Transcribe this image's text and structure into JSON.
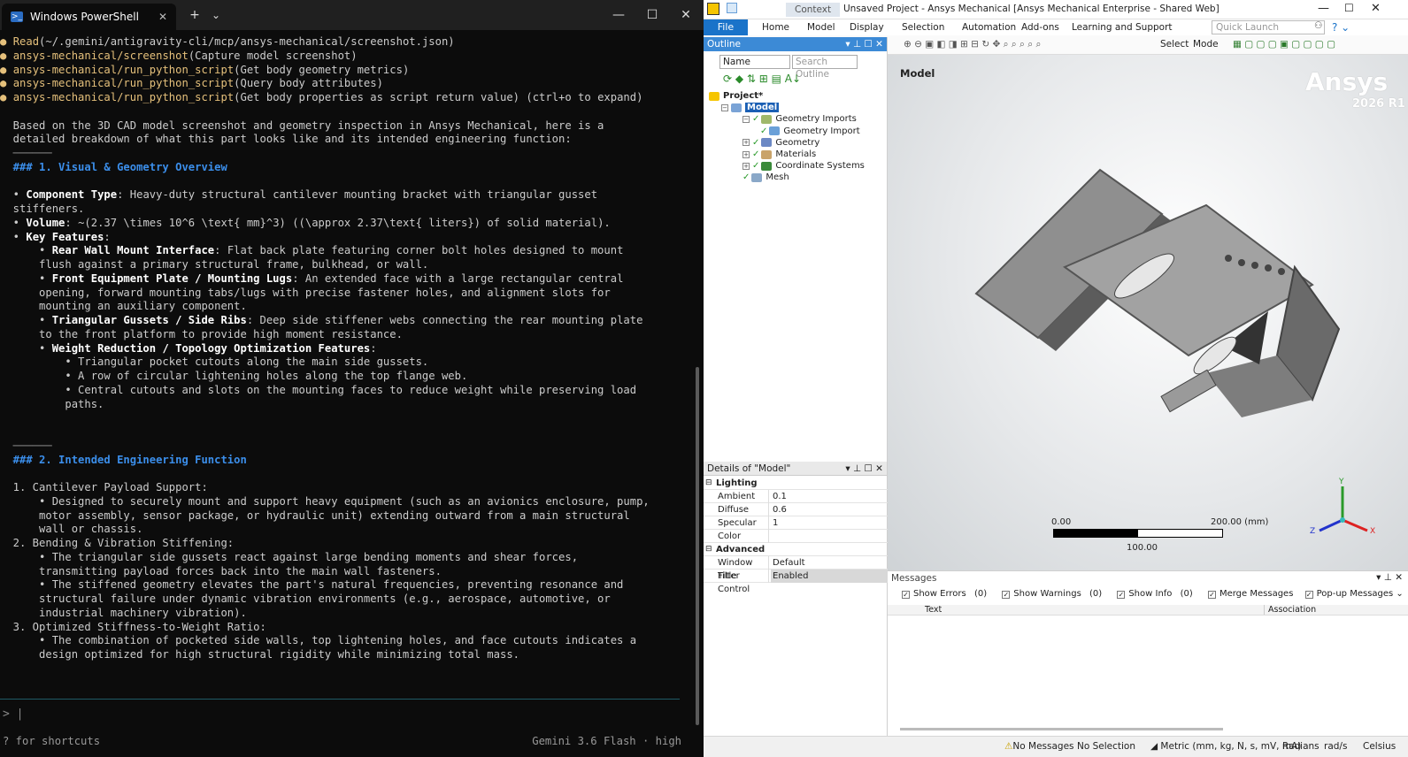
{
  "terminal": {
    "tab_title": "Windows PowerShell",
    "new_tab": "+",
    "tab_dropdown": "⌄",
    "minimize": "—",
    "maximize": "☐",
    "close": "✕",
    "lines": [
      {
        "type": "tool",
        "name": "Read",
        "arg": "(~/.gemini/antigravity-cli/mcp/ansys-mechanical/screenshot.json)"
      },
      {
        "type": "tool",
        "name": "ansys-mechanical/screenshot",
        "arg": "(Capture model screenshot)"
      },
      {
        "type": "tool",
        "name": "ansys-mechanical/run_python_script",
        "arg": "(Get body geometry metrics)"
      },
      {
        "type": "tool",
        "name": "ansys-mechanical/run_python_script",
        "arg": "(Query body attributes)"
      },
      {
        "type": "tool",
        "name": "ansys-mechanical/run_python_script",
        "arg": "(Get body properties as script return value) (ctrl+o to expand)"
      },
      {
        "type": "blank"
      },
      {
        "type": "text",
        "text": "  Based on the 3D CAD model screenshot and geometry inspection in Ansys Mechanical, here is a"
      },
      {
        "type": "text",
        "text": "  detailed breakdown of what this part looks like and its intended engineering function:"
      },
      {
        "type": "sep",
        "text": "  ──────"
      },
      {
        "type": "hdr",
        "text": "  ### 1. Visual & Geometry Overview"
      },
      {
        "type": "blank"
      },
      {
        "type": "mix",
        "pre": "  • ",
        "bold": "Component Type",
        "post": ": Heavy-duty structural cantilever mounting bracket with triangular gusset"
      },
      {
        "type": "text",
        "text": "  stiffeners."
      },
      {
        "type": "mix",
        "pre": "  • ",
        "bold": "Volume",
        "post": ": ~(2.37 \\times 10^6 \\text{ mm}^3) ((\\approx 2.37\\text{ liters}) of solid material)."
      },
      {
        "type": "mix",
        "pre": "  • ",
        "bold": "Key Features",
        "post": ":"
      },
      {
        "type": "mix",
        "pre": "      • ",
        "bold": "Rear Wall Mount Interface",
        "post": ": Flat back plate featuring corner bolt holes designed to mount"
      },
      {
        "type": "text",
        "text": "      flush against a primary structural frame, bulkhead, or wall."
      },
      {
        "type": "mix",
        "pre": "      • ",
        "bold": "Front Equipment Plate / Mounting Lugs",
        "post": ": An extended face with a large rectangular central"
      },
      {
        "type": "text",
        "text": "      opening, forward mounting tabs/lugs with precise fastener holes, and alignment slots for"
      },
      {
        "type": "text",
        "text": "      mounting an auxiliary component."
      },
      {
        "type": "mix",
        "pre": "      • ",
        "bold": "Triangular Gussets / Side Ribs",
        "post": ": Deep side stiffener webs connecting the rear mounting plate"
      },
      {
        "type": "text",
        "text": "      to the front platform to provide high moment resistance."
      },
      {
        "type": "mix",
        "pre": "      • ",
        "bold": "Weight Reduction / Topology Optimization Features",
        "post": ":"
      },
      {
        "type": "text",
        "text": "          • Triangular pocket cutouts along the main side gussets."
      },
      {
        "type": "text",
        "text": "          • A row of circular lightening holes along the top flange web."
      },
      {
        "type": "text",
        "text": "          • Central cutouts and slots on the mounting faces to reduce weight while preserving load"
      },
      {
        "type": "text",
        "text": "          paths."
      },
      {
        "type": "blank"
      },
      {
        "type": "blank"
      },
      {
        "type": "sep",
        "text": "  ──────"
      },
      {
        "type": "hdr",
        "text": "  ### 2. Intended Engineering Function"
      },
      {
        "type": "blank"
      },
      {
        "type": "text",
        "text": "  1. Cantilever Payload Support:"
      },
      {
        "type": "text",
        "text": "      • Designed to securely mount and support heavy equipment (such as an avionics enclosure, pump,"
      },
      {
        "type": "text",
        "text": "      motor assembly, sensor package, or hydraulic unit) extending outward from a main structural"
      },
      {
        "type": "text",
        "text": "      wall or chassis."
      },
      {
        "type": "text",
        "text": "  2. Bending & Vibration Stiffening:"
      },
      {
        "type": "text",
        "text": "      • The triangular side gussets react against large bending moments and shear forces,"
      },
      {
        "type": "text",
        "text": "      transmitting payload forces back into the main wall fasteners."
      },
      {
        "type": "text",
        "text": "      • The stiffened geometry elevates the part's natural frequencies, preventing resonance and"
      },
      {
        "type": "text",
        "text": "      structural failure under dynamic vibration environments (e.g., aerospace, automotive, or"
      },
      {
        "type": "text",
        "text": "      industrial machinery vibration)."
      },
      {
        "type": "text",
        "text": "  3. Optimized Stiffness-to-Weight Ratio:"
      },
      {
        "type": "text",
        "text": "      • The combination of pocketed side walls, top lightening holes, and face cutouts indicates a"
      },
      {
        "type": "text",
        "text": "      design optimized for high structural rigidity while minimizing total mass."
      }
    ],
    "prompt": "> |",
    "footer_left": "? for shortcuts",
    "footer_right": "Gemini 3.6 Flash · high",
    "bullet_color": "#e5c07b",
    "heading_color": "#3b8eea"
  },
  "ansys": {
    "context_tab": "Context",
    "title": "Unsaved Project - Ansys Mechanical [Ansys Mechanical Enterprise - Shared Web]",
    "menus": [
      "File",
      "Home",
      "Model",
      "Display",
      "Selection",
      "Automation",
      "Add-ons",
      "Learning and Support"
    ],
    "quick_launch": "Quick Launch",
    "toolbar_select": "Select",
    "toolbar_mode": "Mode",
    "outline": {
      "title": "Outline",
      "name_dropdown": "Name",
      "search_placeholder": "Search Outline",
      "tree": [
        {
          "label": "Project*",
          "depth": 0
        },
        {
          "label": "Model",
          "depth": 1
        },
        {
          "label": "Geometry Imports",
          "depth": 2
        },
        {
          "label": "Geometry Import",
          "depth": 3
        },
        {
          "label": "Geometry",
          "depth": 2
        },
        {
          "label": "Materials",
          "depth": 2
        },
        {
          "label": "Coordinate Systems",
          "depth": 2
        },
        {
          "label": "Mesh",
          "depth": 2
        }
      ]
    },
    "details": {
      "title": "Details of \"Model\"",
      "sections": [
        {
          "name": "Lighting",
          "rows": [
            [
              "Ambient",
              "0.1"
            ],
            [
              "Diffuse",
              "0.6"
            ],
            [
              "Specular",
              "1"
            ],
            [
              "Color",
              ""
            ]
          ]
        },
        {
          "name": "Advanced",
          "rows": [
            [
              "Window Title",
              "Default"
            ],
            [
              "Filter Control",
              "Enabled"
            ]
          ]
        }
      ]
    },
    "viewport": {
      "label": "Model",
      "brand": "Ansys",
      "version": "2026 R1",
      "scale_left": "0.00",
      "scale_right": "200.00 (mm)",
      "scale_mid": "100.00",
      "axis_x": "X",
      "axis_y": "Y",
      "axis_z": "Z"
    },
    "messages": {
      "title": "Messages",
      "filters": [
        "Show Errors",
        "(0)",
        "Show Warnings",
        "(0)",
        "Show Info",
        "(0)",
        "Merge Messages",
        "Pop-up Messages"
      ],
      "columns": [
        "Text",
        "Association"
      ]
    },
    "status": {
      "messages": "No Messages",
      "selection": "No Selection",
      "units": "Metric (mm, kg, N, s, mV, mA)",
      "angle": "Radians",
      "rot": "rad/s",
      "temp": "Celsius"
    }
  }
}
